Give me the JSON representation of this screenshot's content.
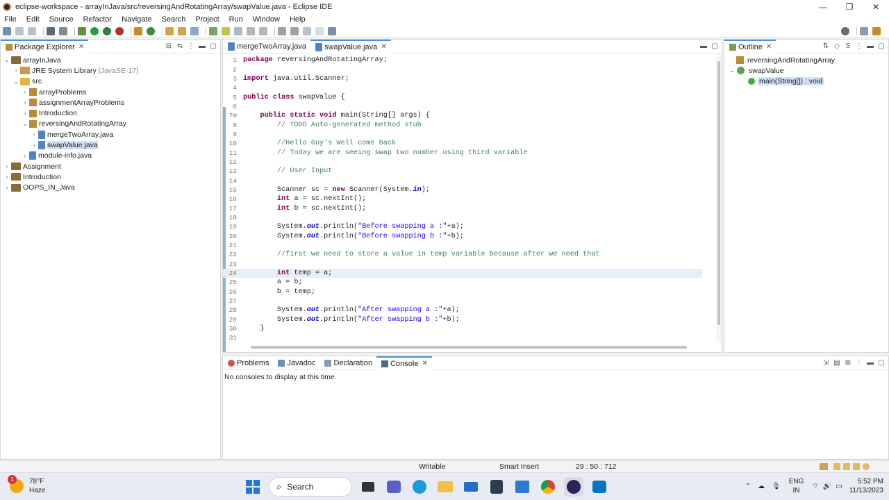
{
  "window": {
    "title": "eclipse-workspace - arrayInJava/src/reversingAndRotatingArray/swapValue.java - Eclipse IDE",
    "controls": [
      "—",
      "❐",
      "✕"
    ]
  },
  "menu": [
    "File",
    "Edit",
    "Source",
    "Refactor",
    "Navigate",
    "Search",
    "Project",
    "Run",
    "Window",
    "Help"
  ],
  "package_explorer": {
    "title": "Package Explorer",
    "rows": [
      {
        "indent": 0,
        "twisty": "⌄",
        "icon": "project-icon",
        "label": "arrayInJava",
        "suffix": "",
        "selected": false
      },
      {
        "indent": 1,
        "twisty": "›",
        "icon": "library-icon",
        "label": "JRE System Library",
        "suffix": "[JavaSE-17]",
        "selected": false
      },
      {
        "indent": 1,
        "twisty": "⌄",
        "icon": "src-folder-icon",
        "label": "src",
        "suffix": "",
        "selected": false
      },
      {
        "indent": 2,
        "twisty": "›",
        "icon": "package-icon",
        "label": "arrayProblems",
        "suffix": "",
        "selected": false
      },
      {
        "indent": 2,
        "twisty": "›",
        "icon": "package-icon",
        "label": "assignmentArrayProblems",
        "suffix": "",
        "selected": false
      },
      {
        "indent": 2,
        "twisty": "›",
        "icon": "package-icon",
        "label": "Introduction",
        "suffix": "",
        "selected": false
      },
      {
        "indent": 2,
        "twisty": "⌄",
        "icon": "package-icon",
        "label": "reversingAndRotatingArray",
        "suffix": "",
        "selected": false
      },
      {
        "indent": 3,
        "twisty": "›",
        "icon": "java-file-icon",
        "label": "mergeTwoArray.java",
        "suffix": "",
        "selected": false
      },
      {
        "indent": 3,
        "twisty": "›",
        "icon": "java-file-icon",
        "label": "swapValue.java",
        "suffix": "",
        "selected": true
      },
      {
        "indent": 2,
        "twisty": "›",
        "icon": "java-file-icon",
        "label": "module-info.java",
        "suffix": "",
        "selected": false
      },
      {
        "indent": 0,
        "twisty": "›",
        "icon": "project-icon",
        "label": "Assignment",
        "suffix": "",
        "selected": false
      },
      {
        "indent": 0,
        "twisty": "›",
        "icon": "project-icon",
        "label": "Introduction",
        "suffix": "",
        "selected": false
      },
      {
        "indent": 0,
        "twisty": "›",
        "icon": "project-icon",
        "label": "OOPS_IN_Java",
        "suffix": "",
        "selected": false
      }
    ]
  },
  "editor": {
    "tabs": [
      {
        "label": "mergeTwoArray.java",
        "active": false
      },
      {
        "label": "swapValue.java",
        "active": true
      }
    ],
    "current_line": 24,
    "lines": [
      {
        "n": "1",
        "parts": [
          [
            "kw",
            "package"
          ],
          [
            "",
            " reversingAndRotatingArray;"
          ]
        ]
      },
      {
        "n": "2",
        "parts": []
      },
      {
        "n": "3",
        "parts": [
          [
            "kw",
            "import"
          ],
          [
            "",
            " java.util.Scanner;"
          ]
        ]
      },
      {
        "n": "4",
        "parts": []
      },
      {
        "n": "5",
        "parts": [
          [
            "kw",
            "public class"
          ],
          [
            "",
            " swapValue {"
          ]
        ]
      },
      {
        "n": "6",
        "parts": []
      },
      {
        "n": "7⊖",
        "parts": [
          [
            "",
            "    "
          ],
          [
            "kw",
            "public static void"
          ],
          [
            "",
            " main(String[] args) {"
          ]
        ]
      },
      {
        "n": "8",
        "parts": [
          [
            "",
            "        "
          ],
          [
            "cm",
            "// TODO Auto-generated method stub"
          ]
        ]
      },
      {
        "n": "9",
        "parts": []
      },
      {
        "n": "10",
        "parts": [
          [
            "",
            "        "
          ],
          [
            "cm",
            "//Hello Guy's Well come back"
          ]
        ]
      },
      {
        "n": "11",
        "parts": [
          [
            "",
            "        "
          ],
          [
            "cm",
            "// Today we are seeing swap two number using third variable"
          ]
        ]
      },
      {
        "n": "12",
        "parts": []
      },
      {
        "n": "13",
        "parts": [
          [
            "",
            "        "
          ],
          [
            "cm",
            "// User Input"
          ]
        ]
      },
      {
        "n": "14",
        "parts": []
      },
      {
        "n": "15",
        "parts": [
          [
            "",
            "        Scanner sc = "
          ],
          [
            "kw",
            "new"
          ],
          [
            "",
            " Scanner(System."
          ],
          [
            "fld",
            "in"
          ],
          [
            "",
            ");"
          ]
        ]
      },
      {
        "n": "16",
        "parts": [
          [
            "",
            "        "
          ],
          [
            "kw",
            "int"
          ],
          [
            "",
            " a = sc.nextInt();"
          ]
        ]
      },
      {
        "n": "17",
        "parts": [
          [
            "",
            "        "
          ],
          [
            "kw",
            "int"
          ],
          [
            "",
            " b = sc.nextInt();"
          ]
        ]
      },
      {
        "n": "18",
        "parts": []
      },
      {
        "n": "19",
        "parts": [
          [
            "",
            "        System."
          ],
          [
            "fld",
            "out"
          ],
          [
            "",
            ".println("
          ],
          [
            "st",
            "\"Before swapping a :\""
          ],
          [
            "",
            "+a);"
          ]
        ]
      },
      {
        "n": "20",
        "parts": [
          [
            "",
            "        System."
          ],
          [
            "fld",
            "out"
          ],
          [
            "",
            ".println("
          ],
          [
            "st",
            "\"Before swapping b :\""
          ],
          [
            "",
            "+b);"
          ]
        ]
      },
      {
        "n": "21",
        "parts": []
      },
      {
        "n": "22",
        "parts": [
          [
            "",
            "        "
          ],
          [
            "cm",
            "//first we need to store a value in temp variable because after we need that"
          ]
        ]
      },
      {
        "n": "23",
        "parts": []
      },
      {
        "n": "24",
        "parts": [
          [
            "",
            "        "
          ],
          [
            "kw",
            "int"
          ],
          [
            "",
            " temp = a;"
          ]
        ]
      },
      {
        "n": "25",
        "parts": [
          [
            "",
            "        a = b;"
          ]
        ]
      },
      {
        "n": "26",
        "parts": [
          [
            "",
            "        b = temp;"
          ]
        ]
      },
      {
        "n": "27",
        "parts": []
      },
      {
        "n": "28",
        "parts": [
          [
            "",
            "        System."
          ],
          [
            "fld",
            "out"
          ],
          [
            "",
            ".println("
          ],
          [
            "st",
            "\"After swapping a :\""
          ],
          [
            "",
            "+a);"
          ]
        ]
      },
      {
        "n": "29",
        "parts": [
          [
            "",
            "        System."
          ],
          [
            "fld",
            "out"
          ],
          [
            "",
            ".println("
          ],
          [
            "st",
            "\"After swapping b :\""
          ],
          [
            "",
            "+b);"
          ]
        ]
      },
      {
        "n": "30",
        "parts": [
          [
            "",
            "    }"
          ]
        ]
      },
      {
        "n": "31",
        "parts": []
      }
    ]
  },
  "outline": {
    "title": "Outline",
    "rows": [
      {
        "indent": 0,
        "twisty": "",
        "icon": "package-icon",
        "label": "reversingAndRotatingArray",
        "selected": false
      },
      {
        "indent": 0,
        "twisty": "⌄",
        "icon": "class-icon",
        "label": "swapValue",
        "selected": false
      },
      {
        "indent": 1,
        "twisty": "",
        "icon": "method-icon",
        "label": "main(String[]) : void",
        "selected": true
      }
    ]
  },
  "bottom_panel": {
    "tabs": [
      {
        "label": "Problems",
        "active": false
      },
      {
        "label": "Javadoc",
        "active": false
      },
      {
        "label": "Declaration",
        "active": false
      },
      {
        "label": "Console",
        "active": true
      }
    ],
    "message": "No consoles to display at this time."
  },
  "status": {
    "writable": "Writable",
    "insert_mode": "Smart Insert",
    "position": "29 : 50 : 712"
  },
  "taskbar": {
    "weather_temp": "78°F",
    "weather_desc": "Haze",
    "notification_count": "1",
    "search_label": "Search",
    "language": "ENG",
    "region": "IN",
    "time": "5:52 PM",
    "date": "11/13/2023"
  }
}
